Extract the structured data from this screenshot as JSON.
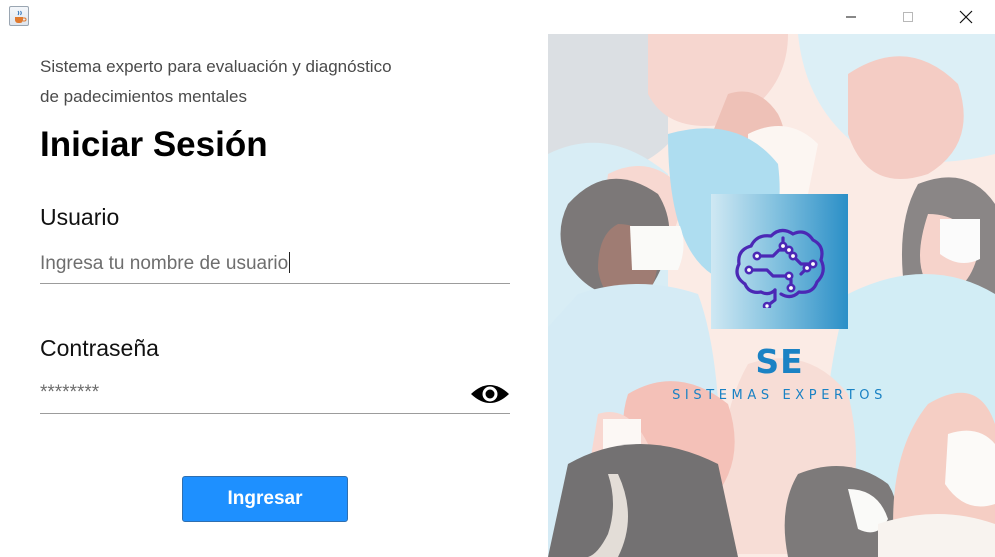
{
  "window": {
    "app_icon": "java-coffee-icon",
    "controls": {
      "minimize_icon": "minimize-icon",
      "maximize_icon": "maximize-icon",
      "close_icon": "close-icon"
    }
  },
  "login": {
    "subtitle_line1": "Sistema experto para evaluación y diagnóstico",
    "subtitle_line2": "de padecimientos mentales",
    "heading": "Iniciar Sesión",
    "user_label": "Usuario",
    "user_placeholder": "Ingresa tu nombre de usuario",
    "password_label": "Contraseña",
    "password_value": "********",
    "toggle_icon": "eye-icon",
    "submit_label": "Ingresar"
  },
  "branding": {
    "logo_icon": "brain-circuit-icon",
    "title": "SE",
    "subtitle": "SISTEMAS EXPERTOS"
  },
  "colors": {
    "button": "#1e90ff",
    "brand": "#1a82c4",
    "logo_circuit": "#4b28b5"
  }
}
